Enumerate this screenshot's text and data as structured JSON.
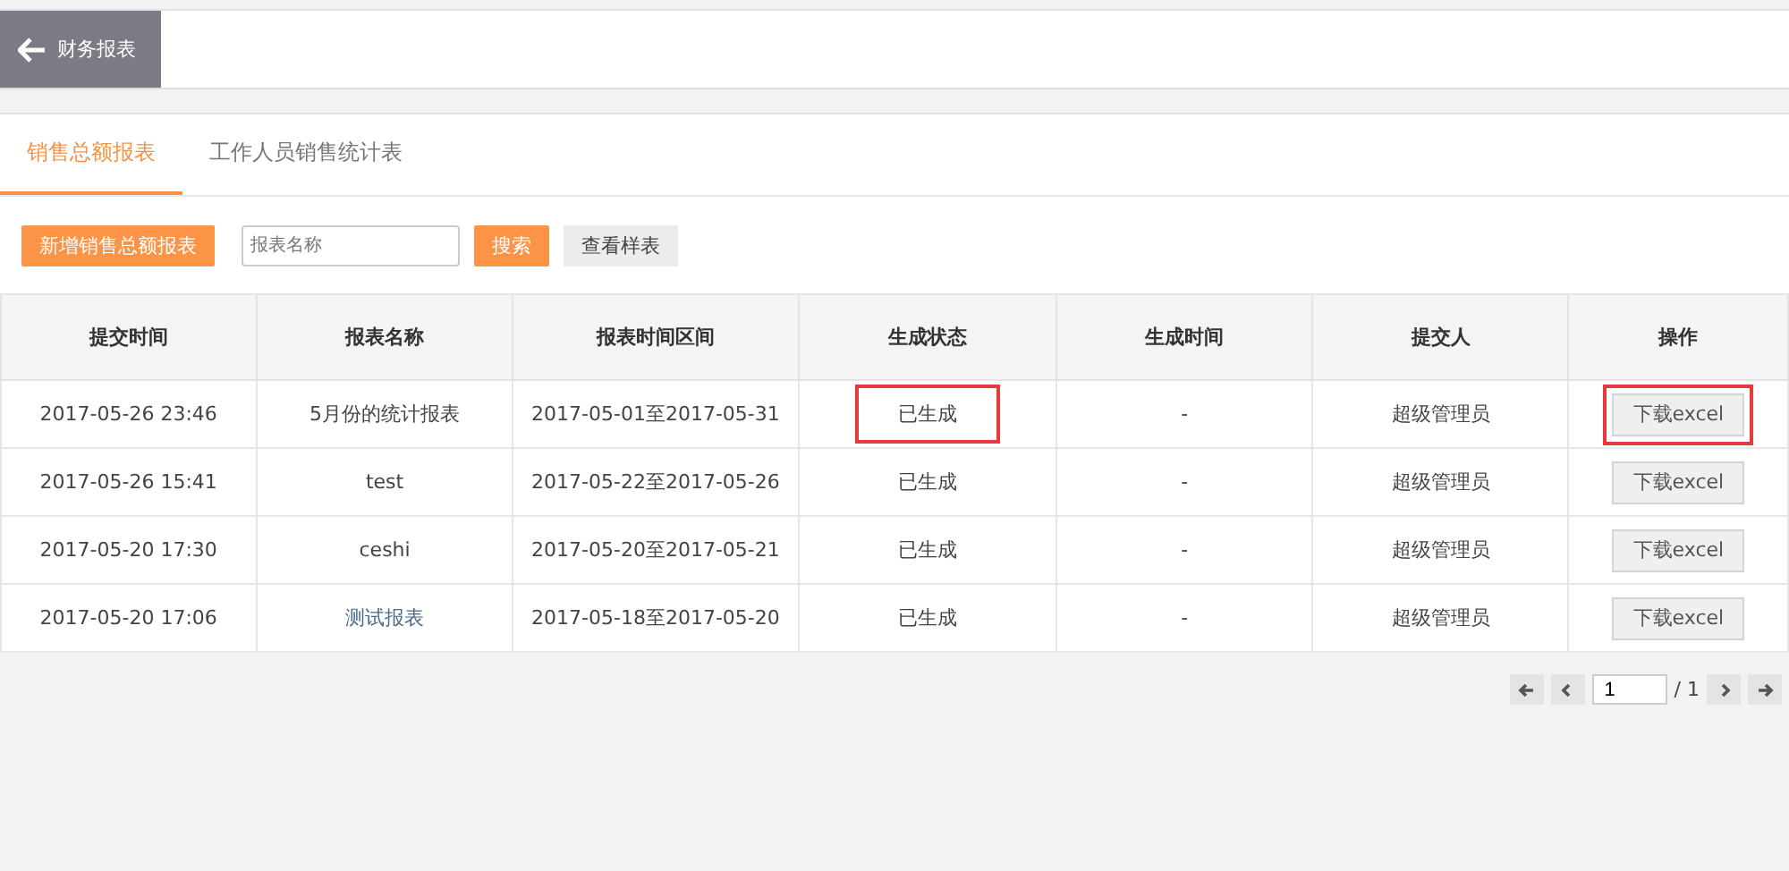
{
  "header": {
    "back_label": "财务报表"
  },
  "tabs": [
    {
      "label": "销售总额报表",
      "selected": true
    },
    {
      "label": "工作人员销售统计表",
      "selected": false
    }
  ],
  "toolbar": {
    "add_button": "新增销售总额报表",
    "search": {
      "placeholder": "报表名称"
    },
    "search_button": "搜索",
    "sample_button": "查看样表"
  },
  "table": {
    "columns": [
      "提交时间",
      "报表名称",
      "报表时间区间",
      "生成状态",
      "生成时间",
      "提交人",
      "操作"
    ],
    "rows": [
      {
        "submitted": "2017-05-26 23:46",
        "name": "5月份的统计报表",
        "period": "2017-05-01至2017-05-31",
        "status": "已生成",
        "generated": "-",
        "submitter": "超级管理员",
        "action": "下载excel",
        "highlighted": true
      },
      {
        "submitted": "2017-05-26 15:41",
        "name": "test",
        "period": "2017-05-22至2017-05-26",
        "status": "已生成",
        "generated": "-",
        "submitter": "超级管理员",
        "action": "下载excel",
        "highlighted": false
      },
      {
        "submitted": "2017-05-20 17:30",
        "name": "ceshi",
        "period": "2017-05-20至2017-05-21",
        "status": "已生成",
        "generated": "-",
        "submitter": "超级管理员",
        "action": "下载excel",
        "highlighted": false
      },
      {
        "submitted": "2017-05-20 17:06",
        "name": "测试报表",
        "period": "2017-05-18至2017-05-20",
        "status": "已生成",
        "generated": "-",
        "submitter": "超级管理员",
        "action": "下载excel",
        "highlighted": false
      }
    ]
  },
  "pagination": {
    "page": "1",
    "total": "/ 1"
  }
}
